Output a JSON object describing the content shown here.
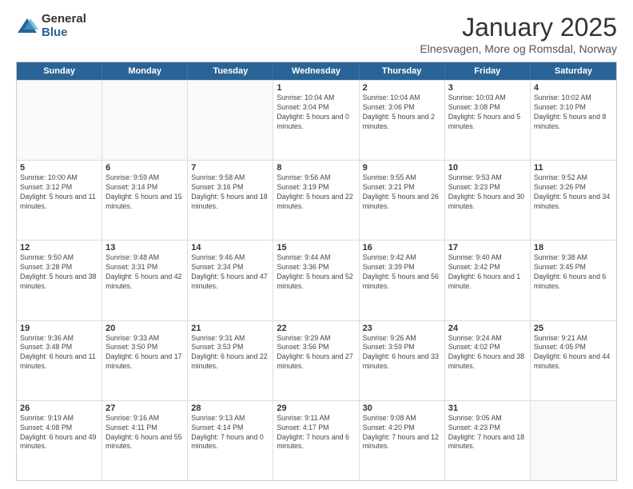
{
  "logo": {
    "general": "General",
    "blue": "Blue"
  },
  "title": "January 2025",
  "subtitle": "Elnesvagen, More og Romsdal, Norway",
  "days_of_week": [
    "Sunday",
    "Monday",
    "Tuesday",
    "Wednesday",
    "Thursday",
    "Friday",
    "Saturday"
  ],
  "weeks": [
    [
      {
        "day": "",
        "info": "",
        "empty": true
      },
      {
        "day": "",
        "info": "",
        "empty": true
      },
      {
        "day": "",
        "info": "",
        "empty": true
      },
      {
        "day": "1",
        "info": "Sunrise: 10:04 AM\nSunset: 3:04 PM\nDaylight: 5 hours and 0 minutes."
      },
      {
        "day": "2",
        "info": "Sunrise: 10:04 AM\nSunset: 3:06 PM\nDaylight: 5 hours and 2 minutes."
      },
      {
        "day": "3",
        "info": "Sunrise: 10:03 AM\nSunset: 3:08 PM\nDaylight: 5 hours and 5 minutes."
      },
      {
        "day": "4",
        "info": "Sunrise: 10:02 AM\nSunset: 3:10 PM\nDaylight: 5 hours and 8 minutes."
      }
    ],
    [
      {
        "day": "5",
        "info": "Sunrise: 10:00 AM\nSunset: 3:12 PM\nDaylight: 5 hours and 11 minutes."
      },
      {
        "day": "6",
        "info": "Sunrise: 9:59 AM\nSunset: 3:14 PM\nDaylight: 5 hours and 15 minutes."
      },
      {
        "day": "7",
        "info": "Sunrise: 9:58 AM\nSunset: 3:16 PM\nDaylight: 5 hours and 18 minutes."
      },
      {
        "day": "8",
        "info": "Sunrise: 9:56 AM\nSunset: 3:19 PM\nDaylight: 5 hours and 22 minutes."
      },
      {
        "day": "9",
        "info": "Sunrise: 9:55 AM\nSunset: 3:21 PM\nDaylight: 5 hours and 26 minutes."
      },
      {
        "day": "10",
        "info": "Sunrise: 9:53 AM\nSunset: 3:23 PM\nDaylight: 5 hours and 30 minutes."
      },
      {
        "day": "11",
        "info": "Sunrise: 9:52 AM\nSunset: 3:26 PM\nDaylight: 5 hours and 34 minutes."
      }
    ],
    [
      {
        "day": "12",
        "info": "Sunrise: 9:50 AM\nSunset: 3:28 PM\nDaylight: 5 hours and 38 minutes."
      },
      {
        "day": "13",
        "info": "Sunrise: 9:48 AM\nSunset: 3:31 PM\nDaylight: 5 hours and 42 minutes."
      },
      {
        "day": "14",
        "info": "Sunrise: 9:46 AM\nSunset: 3:34 PM\nDaylight: 5 hours and 47 minutes."
      },
      {
        "day": "15",
        "info": "Sunrise: 9:44 AM\nSunset: 3:36 PM\nDaylight: 5 hours and 52 minutes."
      },
      {
        "day": "16",
        "info": "Sunrise: 9:42 AM\nSunset: 3:39 PM\nDaylight: 5 hours and 56 minutes."
      },
      {
        "day": "17",
        "info": "Sunrise: 9:40 AM\nSunset: 3:42 PM\nDaylight: 6 hours and 1 minute."
      },
      {
        "day": "18",
        "info": "Sunrise: 9:38 AM\nSunset: 3:45 PM\nDaylight: 6 hours and 6 minutes."
      }
    ],
    [
      {
        "day": "19",
        "info": "Sunrise: 9:36 AM\nSunset: 3:48 PM\nDaylight: 6 hours and 11 minutes."
      },
      {
        "day": "20",
        "info": "Sunrise: 9:33 AM\nSunset: 3:50 PM\nDaylight: 6 hours and 17 minutes."
      },
      {
        "day": "21",
        "info": "Sunrise: 9:31 AM\nSunset: 3:53 PM\nDaylight: 6 hours and 22 minutes."
      },
      {
        "day": "22",
        "info": "Sunrise: 9:29 AM\nSunset: 3:56 PM\nDaylight: 6 hours and 27 minutes."
      },
      {
        "day": "23",
        "info": "Sunrise: 9:26 AM\nSunset: 3:59 PM\nDaylight: 6 hours and 33 minutes."
      },
      {
        "day": "24",
        "info": "Sunrise: 9:24 AM\nSunset: 4:02 PM\nDaylight: 6 hours and 38 minutes."
      },
      {
        "day": "25",
        "info": "Sunrise: 9:21 AM\nSunset: 4:05 PM\nDaylight: 6 hours and 44 minutes."
      }
    ],
    [
      {
        "day": "26",
        "info": "Sunrise: 9:19 AM\nSunset: 4:08 PM\nDaylight: 6 hours and 49 minutes."
      },
      {
        "day": "27",
        "info": "Sunrise: 9:16 AM\nSunset: 4:11 PM\nDaylight: 6 hours and 55 minutes."
      },
      {
        "day": "28",
        "info": "Sunrise: 9:13 AM\nSunset: 4:14 PM\nDaylight: 7 hours and 0 minutes."
      },
      {
        "day": "29",
        "info": "Sunrise: 9:11 AM\nSunset: 4:17 PM\nDaylight: 7 hours and 6 minutes."
      },
      {
        "day": "30",
        "info": "Sunrise: 9:08 AM\nSunset: 4:20 PM\nDaylight: 7 hours and 12 minutes."
      },
      {
        "day": "31",
        "info": "Sunrise: 9:05 AM\nSunset: 4:23 PM\nDaylight: 7 hours and 18 minutes."
      },
      {
        "day": "",
        "info": "",
        "empty": true
      }
    ]
  ]
}
